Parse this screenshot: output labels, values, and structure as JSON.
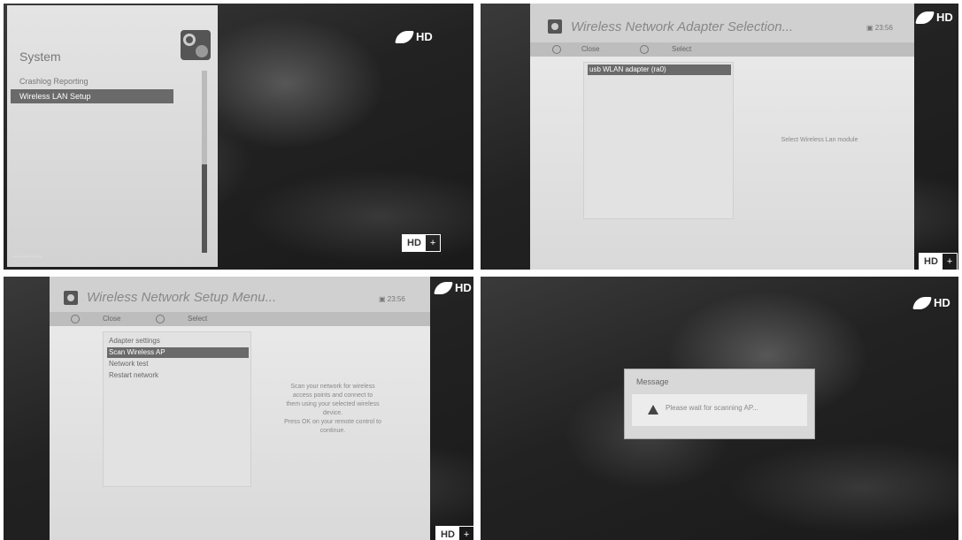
{
  "channel_logo": {
    "text": "HD"
  },
  "hd_badge": {
    "hd": "HD",
    "plus": "+"
  },
  "panel1": {
    "menu_title": "System",
    "items": [
      "Crashlog Reporting",
      "Wireless LAN Setup"
    ],
    "selected_index": 1
  },
  "panel2": {
    "title": "Wireless Network Adapter Selection...",
    "clock": "23:56",
    "buttons": {
      "close": "Close",
      "select": "Select"
    },
    "list_items": [
      "usb WLAN adapter (ra0)"
    ],
    "help": "Select Wireless Lan module"
  },
  "panel3": {
    "title": "Wireless Network Setup Menu...",
    "clock": "23:56",
    "buttons": {
      "close": "Close",
      "select": "Select"
    },
    "list_items": [
      "Adapter settings",
      "Scan Wireless AP",
      "Network test",
      "Restart network"
    ],
    "selected_index": 1,
    "help": [
      "Scan your network for wireless",
      "access points and connect to",
      "them using your selected wireless",
      "device.",
      "Press OK on your remote control to",
      "continue."
    ]
  },
  "panel4": {
    "message_title": "Message",
    "message_text": "Please wait for scanning AP..."
  }
}
